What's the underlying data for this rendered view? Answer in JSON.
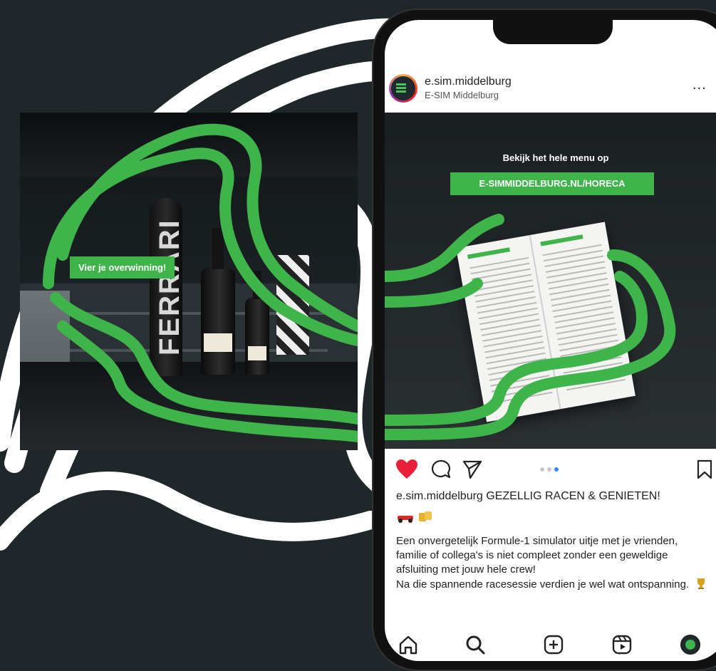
{
  "promo": {
    "label": "Vier je overwinning!",
    "tube_brand": "FERRARI"
  },
  "instagram": {
    "header": {
      "username": "e.sim.middelburg",
      "display_name": "E-SIM Middelburg",
      "more": "..."
    },
    "post": {
      "title": "Bekijk het hele menu op",
      "url": "E-SIMMIDDELBURG.NL/HORECA",
      "carousel_dots": 3,
      "active_dot": 3
    },
    "caption": {
      "username": "e.sim.middelburg",
      "headline": "GEZELLIG RACEN & GENIETEN!",
      "body": "Een onvergetelijk Formule-1 simulator uitje met je vrienden, familie of collega's is niet compleet zonder een geweldige afsluiting met jouw hele crew!\nNa die spannende racesessie verdien je wel wat ontspanning."
    },
    "icons": {
      "like": "heart-icon",
      "comment": "comment-icon",
      "share": "send-icon",
      "save": "bookmark-icon",
      "nav": [
        "home-icon",
        "search-icon",
        "add-icon",
        "reels-icon",
        "profile-icon"
      ]
    }
  },
  "colors": {
    "background": "#1f272a",
    "track_green": "#3fb44b",
    "like_red": "#e8203a",
    "active_dot": "#2a8cff"
  }
}
